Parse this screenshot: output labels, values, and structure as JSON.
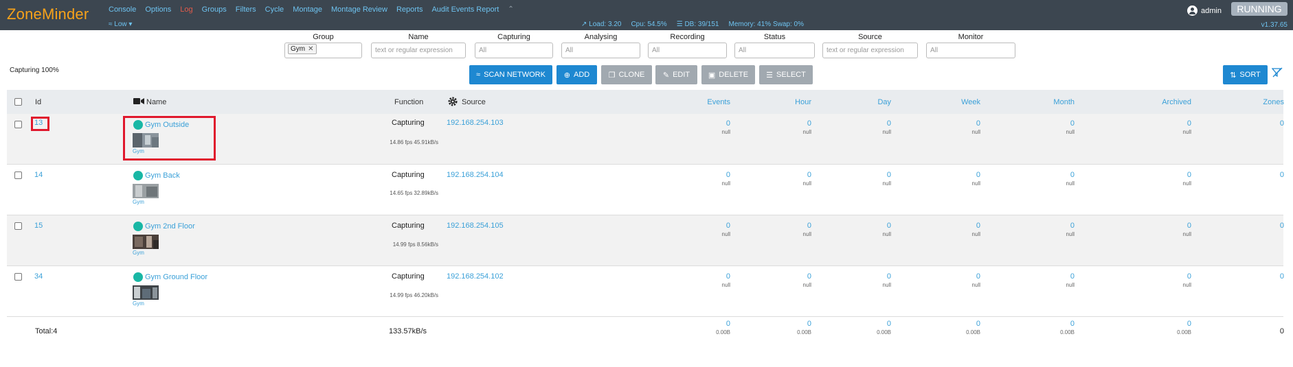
{
  "nav": {
    "brand": "ZoneMinder",
    "menu": [
      "Console",
      "Options",
      "Log",
      "Groups",
      "Filters",
      "Cycle",
      "Montage",
      "Montage Review",
      "Reports",
      "Audit Events Report"
    ],
    "collapse_icon": "chevron-up-icon",
    "bandwidth": "Low",
    "load": "Load: 3.20",
    "cpu": "Cpu: 54.5%",
    "db": "DB: 39/151",
    "memory": "Memory: 41% Swap: 0%",
    "user": "admin",
    "status": "RUNNING",
    "version": "v1.37.65"
  },
  "filters": {
    "group": {
      "label": "Group",
      "chip": "Gym"
    },
    "name": {
      "label": "Name",
      "placeholder": "text or regular expression"
    },
    "capturing": {
      "label": "Capturing",
      "placeholder": "All"
    },
    "analysing": {
      "label": "Analysing",
      "placeholder": "All"
    },
    "recording": {
      "label": "Recording",
      "placeholder": "All"
    },
    "status": {
      "label": "Status",
      "placeholder": "All"
    },
    "source": {
      "label": "Source",
      "placeholder": "text or regular expression"
    },
    "monitor": {
      "label": "Monitor",
      "placeholder": "All"
    }
  },
  "toolbar": {
    "capturing_summary": "Capturing 100%",
    "scan": "SCAN NETWORK",
    "add": "ADD",
    "clone": "CLONE",
    "edit": "EDIT",
    "delete": "DELETE",
    "select": "SELECT",
    "sort": "SORT"
  },
  "table": {
    "headers": {
      "id": "Id",
      "name": "Name",
      "function": "Function",
      "source": "Source",
      "events": "Events",
      "hour": "Hour",
      "day": "Day",
      "week": "Week",
      "month": "Month",
      "archived": "Archived",
      "zones": "Zones"
    },
    "rows": [
      {
        "id": "13",
        "name": "Gym Outside",
        "group": "Gym",
        "function": "Capturing",
        "fps": "14.86 fps 45.91kB/s",
        "source": "192.168.254.103",
        "events": "0",
        "hour": "0",
        "day": "0",
        "week": "0",
        "month": "0",
        "archived": "0",
        "sub": "null",
        "zones": "0"
      },
      {
        "id": "14",
        "name": "Gym Back",
        "group": "Gym",
        "function": "Capturing",
        "fps": "14.65 fps 32.89kB/s",
        "source": "192.168.254.104",
        "events": "0",
        "hour": "0",
        "day": "0",
        "week": "0",
        "month": "0",
        "archived": "0",
        "sub": "null",
        "zones": "0"
      },
      {
        "id": "15",
        "name": "Gym 2nd Floor",
        "group": "Gym",
        "function": "Capturing",
        "fps": "14.99 fps 8.56kB/s",
        "source": "192.168.254.105",
        "events": "0",
        "hour": "0",
        "day": "0",
        "week": "0",
        "month": "0",
        "archived": "0",
        "sub": "null",
        "zones": "0"
      },
      {
        "id": "34",
        "name": "Gym Ground Floor",
        "group": "Gym",
        "function": "Capturing",
        "fps": "14.99 fps 46.20kB/s",
        "source": "192.168.254.102",
        "events": "0",
        "hour": "0",
        "day": "0",
        "week": "0",
        "month": "0",
        "archived": "0",
        "sub": "null",
        "zones": "0"
      }
    ],
    "totals": {
      "label": "Total:4",
      "bandwidth": "133.57kB/s",
      "events": "0",
      "hour": "0",
      "day": "0",
      "week": "0",
      "month": "0",
      "archived": "0",
      "size": "0.00B",
      "zones": "0"
    }
  },
  "colors": {
    "accent": "#3aa0d8",
    "brand": "#f7a21a",
    "navbar": "#3c4650",
    "highlight": "#e0182d",
    "status_dot": "#19b7a5"
  }
}
